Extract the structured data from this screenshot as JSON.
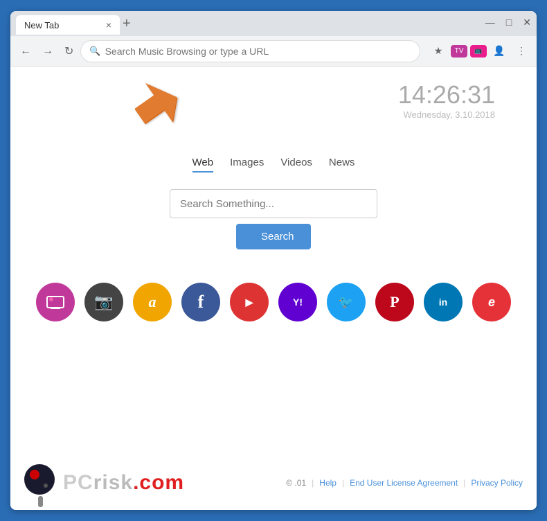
{
  "browser": {
    "tab_title": "New Tab",
    "tab_close": "×",
    "tab_new": "+",
    "window_minimize": "—",
    "window_maximize": "□",
    "window_close": "✕",
    "address_placeholder": "Search Music Browsing or type a URL"
  },
  "clock": {
    "time": "14:26:31",
    "date": "Wednesday, 3.10.2018"
  },
  "search": {
    "tabs": [
      {
        "label": "Web",
        "active": true
      },
      {
        "label": "Images",
        "active": false
      },
      {
        "label": "Videos",
        "active": false
      },
      {
        "label": "News",
        "active": false
      }
    ],
    "placeholder": "Search Something...",
    "button_label": "Search"
  },
  "social": [
    {
      "name": "TV",
      "class": "si-tv",
      "symbol": "📺"
    },
    {
      "name": "Instagram",
      "class": "si-instagram",
      "symbol": "📷"
    },
    {
      "name": "Amazon",
      "class": "si-amazon",
      "symbol": "a"
    },
    {
      "name": "Facebook",
      "class": "si-facebook",
      "symbol": "f"
    },
    {
      "name": "YouTube",
      "class": "si-youtube",
      "symbol": "▶"
    },
    {
      "name": "Yahoo",
      "class": "si-yahoo",
      "symbol": "Y!"
    },
    {
      "name": "Twitter",
      "class": "si-twitter",
      "symbol": "🐦"
    },
    {
      "name": "Pinterest",
      "class": "si-pinterest",
      "symbol": "P"
    },
    {
      "name": "LinkedIn",
      "class": "si-linkedin",
      "symbol": "in"
    },
    {
      "name": "eBay",
      "class": "si-ebay",
      "symbol": "e"
    }
  ],
  "footer": {
    "brand": "PCrisk",
    "brand_colored": ".com",
    "copyright": "© .01",
    "links": [
      "Help",
      "End User License Agreement",
      "Privacy Policy"
    ]
  }
}
